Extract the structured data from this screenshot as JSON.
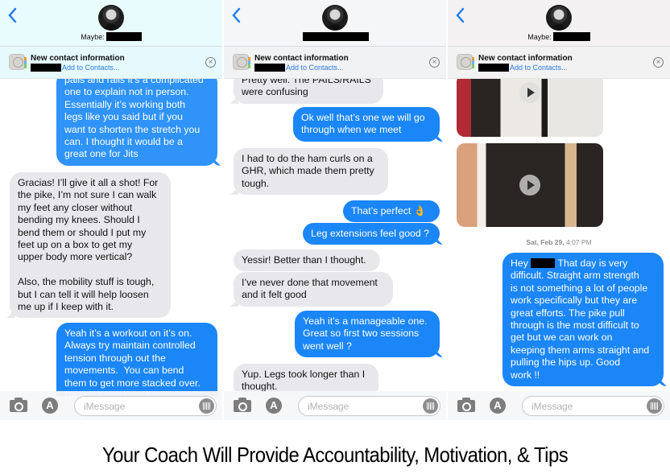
{
  "panels": [
    {
      "header": {
        "contact_label": "Maybe:",
        "contact_redacted": true
      },
      "banner": {
        "title": "New contact information",
        "action": "Add to Contacts...",
        "number_redacted": true
      },
      "messages": [
        {
          "dir": "out",
          "text": "pails and rails it’s a complicated\none to explain not in person.\nEssentially it’s working both\nlegs like you said but if you\nwant to shorten the stretch you\ncan. I thought it would be a\ngreat one for Jits"
        },
        {
          "dir": "in",
          "text": "Gracias! I’ll give it all a shot! For\nthe pike, I’m not sure I can walk\nmy feet any closer without\nbending my knees. Should I\nbend them or should I put my\nfeet up on a box to get my\nupper body more vertical?\n\nAlso, the mobility stuff is tough,\nbut I can tell it will help loosen\nme up if I keep with it."
        },
        {
          "dir": "out",
          "text": "Yeah it’s a workout on it’s on.\nAlways try maintain controlled\ntension through out the\nmovements.  You can bend\nthem to get more stacked over.\nDo you know tight hamstrings?"
        }
      ],
      "input_placeholder": "iMessage"
    },
    {
      "header": {
        "contact_label": "",
        "contact_redacted": true
      },
      "banner": {
        "title": "New contact information",
        "action": "Add to Contacts...",
        "number_redacted": true
      },
      "messages": [
        {
          "dir": "in",
          "text": "Pretty well. The PAILS/RAILS\nwere confusing"
        },
        {
          "dir": "out",
          "text": "Ok well that’s one we will go\nthrough when we meet"
        },
        {
          "dir": "in",
          "text": "I had to do the ham curls on a\nGHR, which made them pretty\ntough."
        },
        {
          "dir": "out",
          "text": "That’s perfect 👌"
        },
        {
          "dir": "out",
          "text": "Leg extensions feel good ?"
        },
        {
          "dir": "in",
          "text": "Yessir! Better than I thought."
        },
        {
          "dir": "in",
          "text": "I’ve never done that movement\nand it felt good"
        },
        {
          "dir": "out",
          "text": "Yeah it’s a manageable one.\nGreat so first two sessions\nwent well ?"
        },
        {
          "dir": "in",
          "text": "Yup. Legs took longer than I\nthought."
        }
      ],
      "input_placeholder": "iMessage"
    },
    {
      "header": {
        "contact_label": "Maybe:",
        "contact_redacted": true
      },
      "banner": {
        "title": "New contact information",
        "action": "Add to Contacts...",
        "number_redacted": true
      },
      "videos": [
        {
          "kind": "video",
          "label": "gym video"
        },
        {
          "kind": "video",
          "label": "kitchen video"
        }
      ],
      "timestamp": {
        "day": "Sat, Feb 29,",
        "time": "4:07 PM"
      },
      "messages": [
        {
          "dir": "out",
          "greeting": "Hey",
          "text": " That day is very\ndifficult. Straight arm strength\nis not something a lot of people\nwork specifically but they are\ngreat efforts. The pike pull\nthrough is the most difficult to\nget but we can work on\nkeeping them arms straight and\npulling the hips up. Good\nwork !!"
        }
      ],
      "input_placeholder": "iMessage"
    }
  ],
  "caption": "Your Coach Will Provide Accountability, Motivation, & Tips",
  "colors": {
    "outgoing": "#1b86f7",
    "incoming": "#e8e8ec",
    "link": "#2a79d6"
  }
}
